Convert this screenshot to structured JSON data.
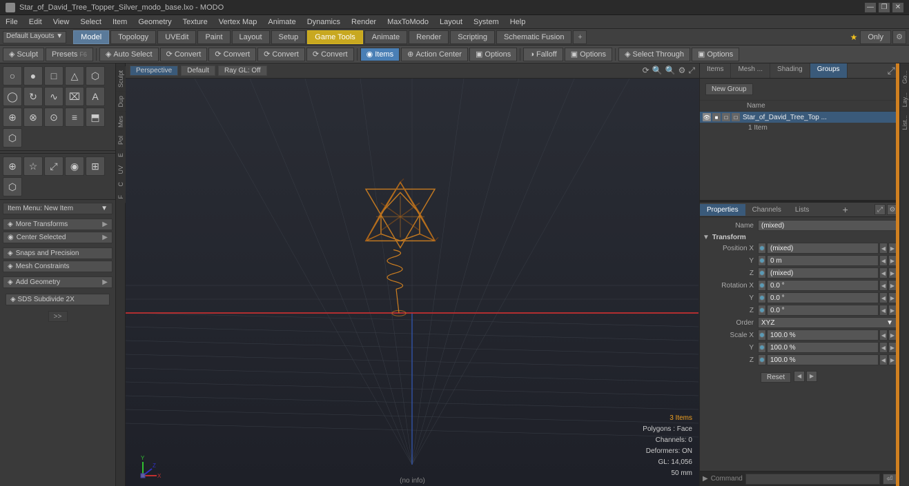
{
  "titlebar": {
    "title": "Star_of_David_Tree_Topper_Silver_modo_base.lxo - MODO",
    "controls": [
      "—",
      "❐",
      "✕"
    ]
  },
  "menubar": {
    "items": [
      "File",
      "Edit",
      "View",
      "Select",
      "Item",
      "Geometry",
      "Texture",
      "Vertex Map",
      "Animate",
      "Dynamics",
      "Render",
      "MaxToModo",
      "Layout",
      "System",
      "Help"
    ]
  },
  "toolbar1": {
    "layout_label": "Default Layouts ▼",
    "tabs": [
      "Model",
      "Topology",
      "UVEdit",
      "Paint",
      "Layout",
      "Setup",
      "Game Tools",
      "Animate",
      "Render",
      "Scripting",
      "Schematic Fusion"
    ],
    "active_tab": "Model",
    "highlight_tab": "Game Tools",
    "plus_label": "+",
    "star_label": "★",
    "only_label": "Only"
  },
  "toolbar2": {
    "tools": [
      {
        "label": "Auto Select",
        "icon": "◈"
      },
      {
        "label": "Convert",
        "icon": "⟳"
      },
      {
        "label": "Convert",
        "icon": "⟳"
      },
      {
        "label": "Convert",
        "icon": "⟳"
      },
      {
        "label": "Convert",
        "icon": "⟳"
      },
      {
        "label": "Items",
        "icon": "◉"
      },
      {
        "label": "Action Center",
        "icon": "⊕"
      },
      {
        "label": "Options",
        "icon": "▣"
      },
      {
        "label": "Falloff",
        "icon": "◑"
      },
      {
        "label": "Options",
        "icon": "▣"
      },
      {
        "label": "Select Through",
        "icon": "◈"
      },
      {
        "label": "Options",
        "icon": "▣"
      }
    ],
    "sculpt_label": "Sculpt",
    "presets_label": "Presets",
    "presets_key": "F6"
  },
  "left_panel": {
    "tool_groups": [
      {
        "icons": [
          "○",
          "●",
          "□",
          "△",
          "⬡",
          "◯",
          "↻",
          "∿",
          "⌧",
          "A",
          "⊕",
          "⊗",
          "⊙",
          "≡",
          "⬒",
          "⬡"
        ]
      },
      {
        "icons": [
          "⊕",
          "☆",
          "⤢",
          "◉",
          "⊞",
          "⬡"
        ]
      }
    ],
    "item_menu_label": "Item Menu: New Item",
    "sections": [
      {
        "label": "More Transforms",
        "has_arrow": true
      },
      {
        "label": "Center Selected",
        "has_arrow": true
      },
      {
        "label": "Snaps and Precision",
        "has_icon": true
      },
      {
        "label": "Mesh Constraints",
        "has_icon": true
      },
      {
        "label": "Add Geometry",
        "has_arrow": true
      }
    ],
    "sds_label": "SDS Subdivide 2X",
    "expand_label": ">>"
  },
  "viewport": {
    "perspective_label": "Perspective",
    "default_label": "Default",
    "ray_gl_label": "Ray GL: Off",
    "status": {
      "items": "3 Items",
      "polygons": "Polygons : Face",
      "channels": "Channels: 0",
      "deformers": "Deformers: ON",
      "gl": "GL: 14,056",
      "size": "50 mm"
    },
    "no_info": "(no info)"
  },
  "right_panel": {
    "top_tabs": [
      "Items",
      "Mesh ...",
      "Shading",
      "Groups"
    ],
    "active_top_tab": "Groups",
    "new_group_label": "New Group",
    "list_header": {
      "name_col": "Name"
    },
    "items": [
      {
        "name": "Star_of_David_Tree_Top ...",
        "count": "1 Item",
        "selected": true
      }
    ],
    "props_tabs": [
      "Properties",
      "Channels",
      "Lists"
    ],
    "active_props_tab": "Properties",
    "properties": {
      "name_label": "Name",
      "name_value": "(mixed)",
      "transform_section": "Transform",
      "position_x_label": "Position X",
      "position_x_value": "(mixed)",
      "position_y_label": "Y",
      "position_y_value": "0 m",
      "position_z_label": "Z",
      "position_z_value": "(mixed)",
      "rotation_x_label": "Rotation X",
      "rotation_x_value": "0.0 °",
      "rotation_y_label": "Y",
      "rotation_y_value": "0.0 °",
      "rotation_z_label": "Z",
      "rotation_z_value": "0.0 °",
      "order_label": "Order",
      "order_value": "XYZ",
      "scale_x_label": "Scale X",
      "scale_x_value": "100.0 %",
      "scale_y_label": "Y",
      "scale_y_value": "100.0 %",
      "scale_z_label": "Z",
      "scale_z_value": "100.0 %",
      "reset_label": "Reset"
    },
    "command_label": "Command",
    "command_placeholder": ""
  },
  "vtabs_left": [
    "Sculpt",
    "Dup",
    "Mes",
    "Pol",
    "E",
    "UV",
    "C",
    "F"
  ],
  "vtabs_right": [
    "Go...",
    "Lay...",
    "List..."
  ],
  "colors": {
    "active_tab_bg": "#4a7fb5",
    "highlight_tab_bg": "#c8a820",
    "viewport_bg": "#22252c",
    "grid_line": "#3a3f48",
    "horizon_line": "#c83030",
    "object_color": "#d08020",
    "accent_orange": "#d08020"
  }
}
